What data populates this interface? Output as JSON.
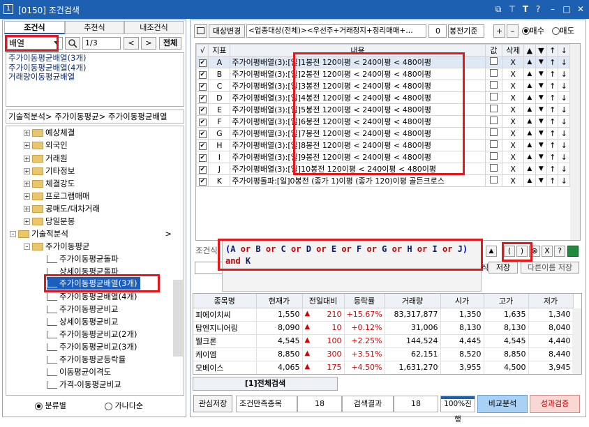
{
  "window": {
    "number": "1",
    "title": "[0150] 조건검색",
    "icons": [
      "window-icon",
      "pin-icon",
      "font-icon",
      "help-icon",
      "minimize-icon",
      "restore-icon",
      "close-icon"
    ],
    "icon_glyphs": [
      "⧉",
      "⊤",
      "T",
      "?",
      "–",
      "□",
      "✕"
    ]
  },
  "left": {
    "tabs": [
      "조건식",
      "추천식",
      "내조건식"
    ],
    "search_value": "배열",
    "page": "1/3",
    "prev": "<",
    "next": ">",
    "all": "전체",
    "results": [
      "주가이동평균배열(3개)",
      "주가이동평균배열(4개)",
      "거래량이동평균배열"
    ],
    "breadcrumb": "기술적분석> 주가이동평균> 주가이동평균배열",
    "tree": [
      {
        "label": "예상체결",
        "type": "folder"
      },
      {
        "label": "외국인",
        "type": "folder"
      },
      {
        "label": "거래원",
        "type": "folder"
      },
      {
        "label": "기타정보",
        "type": "folder"
      },
      {
        "label": "체결강도",
        "type": "folder"
      },
      {
        "label": "프로그램매매",
        "type": "folder"
      },
      {
        "label": "공매도/대차거래",
        "type": "folder"
      },
      {
        "label": "당일분봉",
        "type": "folder"
      },
      {
        "label": "기술적분석",
        "type": "folder-open",
        "arrow": ">"
      },
      {
        "label": "주가이동평균",
        "type": "folder-open-sub"
      },
      {
        "label": "주가이동평균돌파",
        "type": "leaf"
      },
      {
        "label": "상세이동평균돌파",
        "type": "leaf"
      },
      {
        "label": "주가이동평균배열(3개)",
        "type": "leaf-selected"
      },
      {
        "label": "주가이동평균배열(4개)",
        "type": "leaf"
      },
      {
        "label": "주가이동평균비교",
        "type": "leaf"
      },
      {
        "label": "상세이동평균비교",
        "type": "leaf"
      },
      {
        "label": "주가이동평균비교(2개)",
        "type": "leaf"
      },
      {
        "label": "주가이동평균비교(3개)",
        "type": "leaf"
      },
      {
        "label": "주가이동평균등락률",
        "type": "leaf"
      },
      {
        "label": "이동평균이격도",
        "type": "leaf"
      },
      {
        "label": "가격-이동평균비교",
        "type": "leaf"
      }
    ],
    "radio1": "분류별",
    "radio2": "가나다순"
  },
  "right": {
    "target_btn": "대상변경",
    "target_text": "<업종대상(전체)><우선주+거래정지+정리매매+…",
    "spin_value": "0",
    "bong_label": "봉전기준",
    "plus": "+",
    "minus": "–",
    "radio_buy": "매수",
    "radio_sell": "매도",
    "cond_headers": [
      "√",
      "지표",
      "내용",
      "값",
      "삭제",
      "▲",
      "▼",
      "↑",
      "↓"
    ],
    "conditions": [
      {
        "id": "A",
        "name": "주가이평배열(3)",
        "content": "[일]1봉전 120이평 < 240이평 < 480이평"
      },
      {
        "id": "B",
        "name": "주가이평배열(3)",
        "content": "[일]2봉전 120이평 < 240이평 < 480이평"
      },
      {
        "id": "C",
        "name": "주가이평배열(3)",
        "content": "[일]3봉전 120이평 < 240이평 < 480이평"
      },
      {
        "id": "D",
        "name": "주가이평배열(3)",
        "content": "[일]4봉전 120이평 < 240이평 < 480이평"
      },
      {
        "id": "E",
        "name": "주가이평배열(3)",
        "content": "[일]5봉전 120이평 < 240이평 < 480이평"
      },
      {
        "id": "F",
        "name": "주가이평배열(3)",
        "content": "[일]6봉전 120이평 < 240이평 < 480이평"
      },
      {
        "id": "G",
        "name": "주가이평배열(3)",
        "content": "[일]7봉전 120이평 < 240이평 < 480이평"
      },
      {
        "id": "H",
        "name": "주가이평배열(3)",
        "content": "[일]8봉전 120이평 < 240이평 < 480이평"
      },
      {
        "id": "I",
        "name": "주가이평배열(3)",
        "content": "[일]9봉전 120이평 < 240이평 < 480이평"
      },
      {
        "id": "J",
        "name": "주가이평배열(3)",
        "content": "[일]10봉전 120이평 < 240이평 < 480이평"
      },
      {
        "id": "K",
        "name": "주가이평돌파",
        "content": "[일]0봉전 (종가 1)이평 (종가 120)이평 골든크로스"
      }
    ],
    "del_mark": "X",
    "formula_label": "조건식",
    "formula": "(A or B or C or D or E or F or G or H or I or J) and K",
    "formula_tokens": [
      "(",
      "A",
      "or",
      "B",
      "or",
      "C",
      "or",
      "D",
      "or",
      "E",
      "or",
      "F",
      "or",
      "G",
      "or",
      "H",
      "or",
      "I",
      "or",
      "J",
      ")",
      "and",
      "K"
    ],
    "formula_btns": [
      "▲",
      "(",
      ")",
      "⊗",
      "X",
      "?"
    ],
    "save_label": "저장",
    "saveas_label": "다른이름 저장",
    "partial_label": "식",
    "stock_headers": [
      "종목명",
      "현재가",
      "전일대비",
      "등락률",
      "거래량",
      "시가",
      "고가",
      "저가"
    ],
    "stocks": [
      [
        "피에이치씨",
        "1,550",
        "210",
        "+15.67%",
        "83,317,877",
        "1,350",
        "1,635",
        "1,340"
      ],
      [
        "탑엔지니어링",
        "8,090",
        "10",
        "+0.12%",
        "31,006",
        "8,130",
        "8,130",
        "8,040"
      ],
      [
        "웰크론",
        "4,545",
        "100",
        "+2.25%",
        "144,524",
        "4,445",
        "4,545",
        "4,440"
      ],
      [
        "케이엠",
        "8,850",
        "300",
        "+3.51%",
        "62,151",
        "8,520",
        "8,850",
        "8,440"
      ],
      [
        "모베이스",
        "4,065",
        "175",
        "+4.50%",
        "1,631,270",
        "3,955",
        "4,500",
        "3,945"
      ]
    ],
    "bottom_tab": "[1]전체검색",
    "status": {
      "save": "관심저장",
      "match_label": "조건만족종목",
      "match": "18",
      "result_label": "검색결과",
      "result": "18",
      "progress": "100%진행",
      "progress_value": 1.0,
      "compare": "비교분석",
      "perf": "성과검증"
    }
  },
  "colors": {
    "title_bar": "#1d5fb0",
    "highlight": "#e8151b",
    "selected": "#1a5fc0",
    "up": "#d40000"
  }
}
